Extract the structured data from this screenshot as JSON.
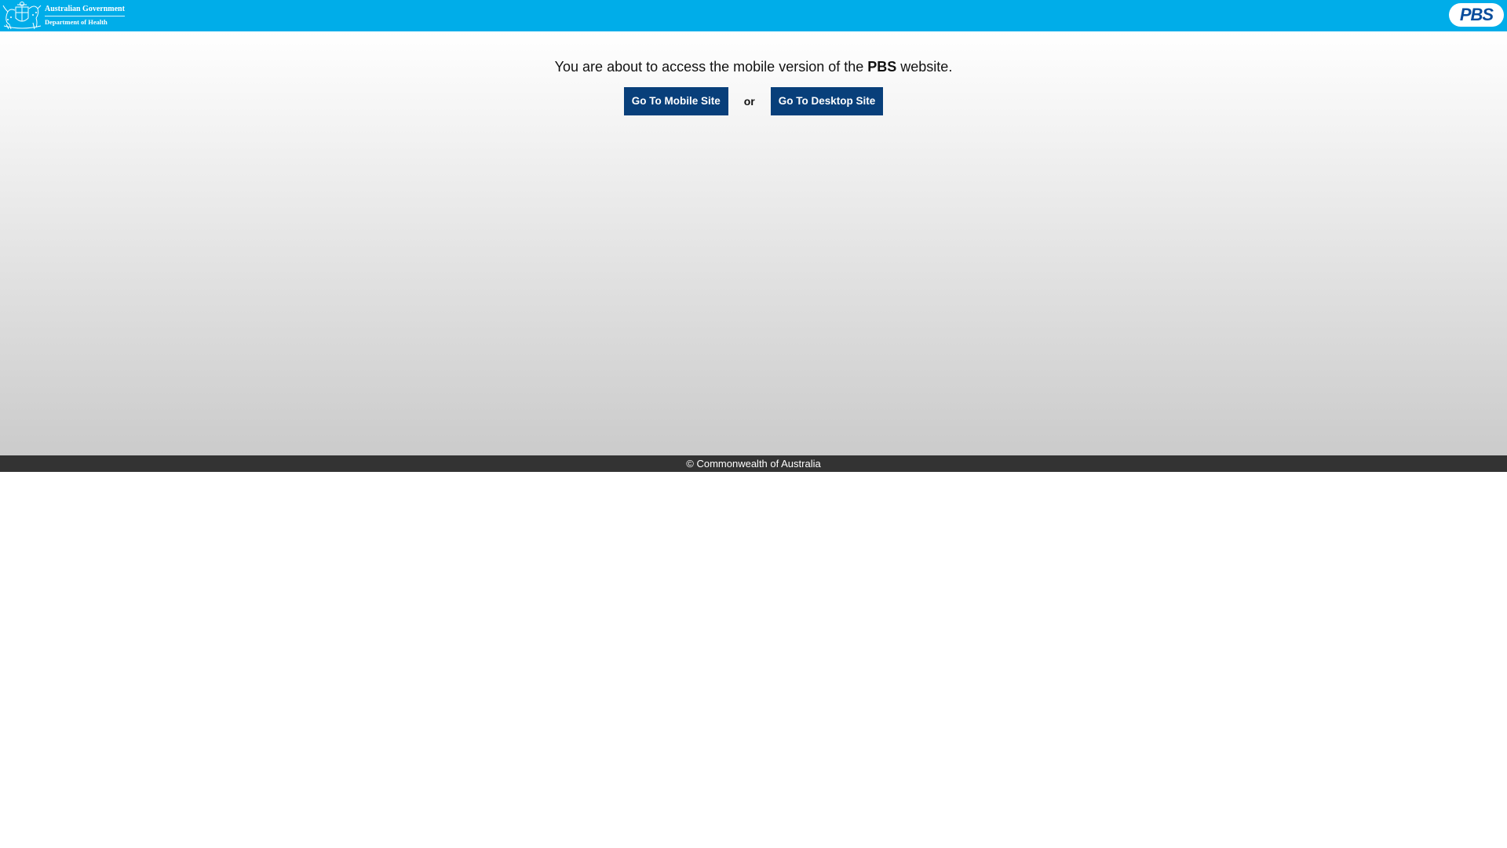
{
  "header": {
    "gov_name": "Australian Government",
    "gov_department": "Department of Health",
    "pbs_logo_text": "PBS",
    "background_color": "#00ade9",
    "crest_icon": "commonwealth-coat-of-arms"
  },
  "main": {
    "message_before": "You are about to access the mobile version of the ",
    "message_brand": "PBS",
    "message_after": " website.",
    "mobile_button_label": "Go To Mobile Site",
    "or_label": "or",
    "desktop_button_label": "Go To Desktop Site",
    "button_color": "#083f7a"
  },
  "footer": {
    "copyright": "© Commonwealth of Australia",
    "background_color": "#333333"
  }
}
